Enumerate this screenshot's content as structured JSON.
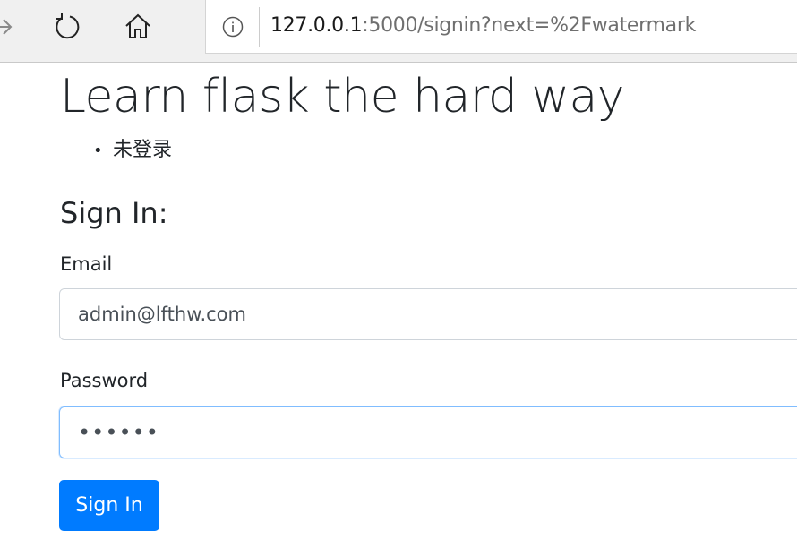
{
  "browser": {
    "url_host": "127.0.0.1",
    "url_rest": ":5000/signin?next=%2Fwatermark",
    "icons": [
      "back-arrow-icon",
      "refresh-icon",
      "home-icon",
      "info-icon"
    ]
  },
  "page": {
    "title": "Learn flask the hard way",
    "status_items": [
      "未登录"
    ]
  },
  "form": {
    "heading": "Sign In:",
    "email_label": "Email",
    "email_value": "admin@lfthw.com",
    "password_label": "Password",
    "password_value": "••••••",
    "submit_label": "Sign In"
  },
  "colors": {
    "primary": "#007bff",
    "focus_border": "#80bdff",
    "text": "#212529"
  }
}
